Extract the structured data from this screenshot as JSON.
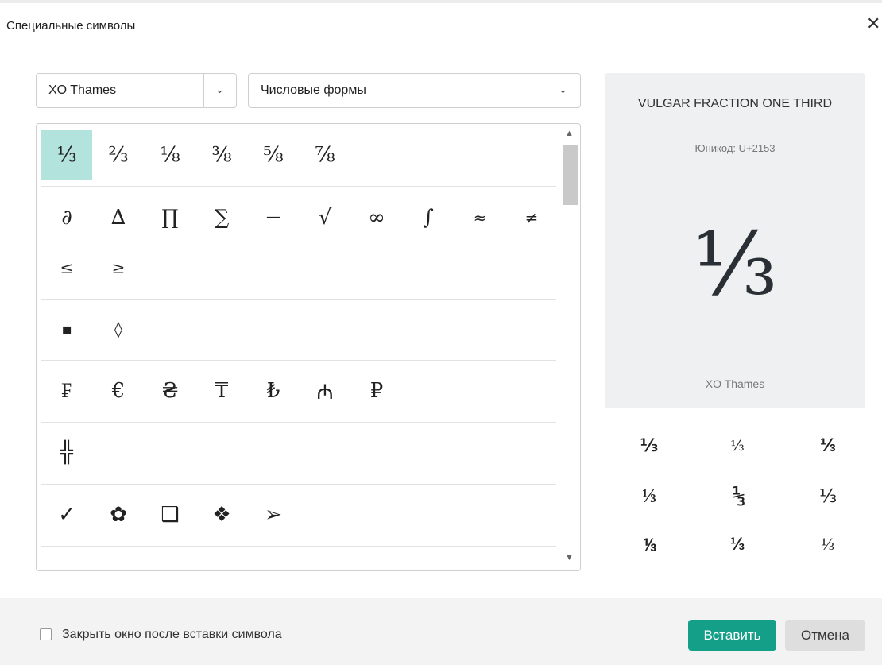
{
  "dialog": {
    "title": "Специальные символы",
    "close_glyph": "✕"
  },
  "font_select": {
    "value": "XO Thames"
  },
  "category_select": {
    "value": "Числовые формы"
  },
  "chevron": "⌄",
  "scroll": {
    "up": "▲",
    "down": "▼"
  },
  "symbols": {
    "row1": [
      "⅓",
      "⅔",
      "⅛",
      "⅜",
      "⅝",
      "⅞"
    ],
    "row2": [
      "∂",
      "∆",
      "∏",
      "∑",
      "−",
      "√",
      "∞",
      "∫",
      "≈",
      "≠"
    ],
    "row3": [
      "≤",
      "≥"
    ],
    "row4": [
      "▪",
      "◊"
    ],
    "row5": [
      "₣",
      "€",
      "₴",
      "₸",
      "₺",
      "₼",
      "₽"
    ],
    "row6": [
      "╬"
    ],
    "row7": [
      "✓",
      "✿",
      "❑",
      "❖",
      "➢"
    ]
  },
  "selected_symbol": "⅓",
  "preview": {
    "name": "VULGAR FRACTION ONE THIRD",
    "code": "Юникод: U+2153",
    "glyph": "⅓",
    "font": "XO Thames"
  },
  "variants": [
    "⅓",
    "⅓",
    "⅓",
    "⅓",
    "⅓",
    "⅓",
    "⅓",
    "⅓",
    "⅓"
  ],
  "footer": {
    "checkbox_label": "Закрыть окно после вставки символа",
    "checkbox_checked": false,
    "insert_label": "Вставить",
    "cancel_label": "Отмена"
  },
  "colors": {
    "accent": "#14a088",
    "selection": "#b2e3dc",
    "preview_bg": "#eef0f1"
  }
}
